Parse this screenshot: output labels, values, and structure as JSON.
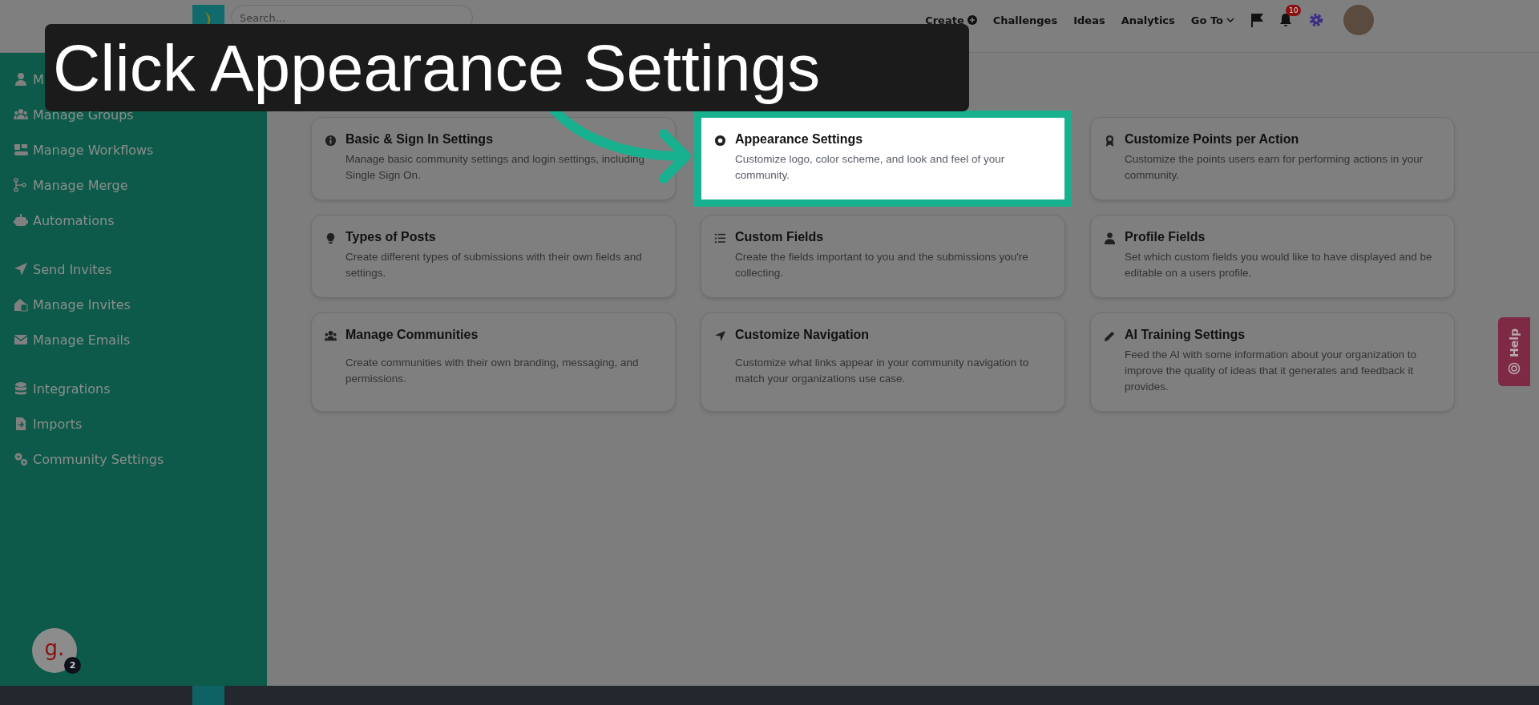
{
  "topbar": {
    "search": {
      "placeholder": "Search..."
    },
    "nav": [
      {
        "label": "Create",
        "kind": "plus"
      },
      {
        "label": "Challenges",
        "kind": "plain"
      },
      {
        "label": "Ideas",
        "kind": "plain"
      },
      {
        "label": "Analytics",
        "kind": "plain"
      },
      {
        "label": "Go To",
        "kind": "dropdown"
      }
    ],
    "notification_count": "10"
  },
  "sidebar": {
    "sections": [
      [
        {
          "label": "M"
        },
        {
          "label": "Manage Groups"
        },
        {
          "label": "Manage Workflows"
        },
        {
          "label": "Manage Merge"
        },
        {
          "label": "Automations"
        }
      ],
      [
        {
          "label": "Send Invites"
        },
        {
          "label": "Manage Invites"
        },
        {
          "label": "Manage Emails"
        }
      ],
      [
        {
          "label": "Integrations"
        },
        {
          "label": "Imports"
        },
        {
          "label": "Community Settings"
        }
      ]
    ]
  },
  "cards": [
    {
      "title": "Basic & Sign In Settings",
      "description": "Manage basic community settings and login settings, including Single Sign On.",
      "highlighted": false
    },
    {
      "title": "Appearance Settings",
      "description": "Customize logo, color scheme, and look and feel of your community.",
      "highlighted": true
    },
    {
      "title": "Customize Points per Action",
      "description": "Customize the points users earn for performing actions in your community.",
      "highlighted": false
    },
    {
      "title": "Types of Posts",
      "description": "Create different types of submissions with their own fields and settings.",
      "highlighted": false
    },
    {
      "title": "Custom Fields",
      "description": "Create the fields important to you and the submissions you're collecting.",
      "highlighted": false
    },
    {
      "title": "Profile Fields",
      "description": "Set which custom fields you would like to have displayed and be editable on a users profile.",
      "highlighted": false
    },
    {
      "title": "Manage Communities",
      "description": "Create communities with their own branding, messaging, and permissions.",
      "highlighted": false
    },
    {
      "title": "Customize Navigation",
      "description": "Customize what links appear in your community navigation to match your organizations use case.",
      "highlighted": false
    },
    {
      "title": "AI Training Settings",
      "description": "Feed the AI with some information about your organization to improve the quality of ideas that it generates and feedback it provides.",
      "highlighted": false
    }
  ],
  "help_tab": {
    "label": "Help"
  },
  "chat_widget": {
    "letter": "g.",
    "badge": "2"
  },
  "callout": {
    "text": "Click Appearance Settings"
  }
}
